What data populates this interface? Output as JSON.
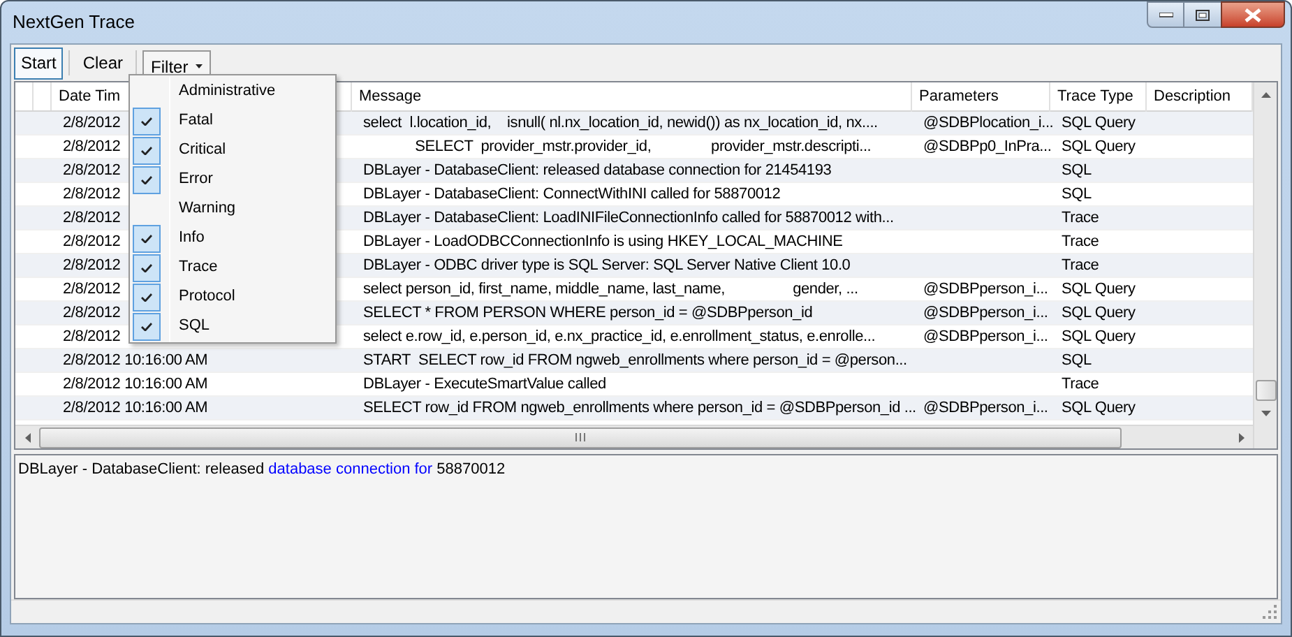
{
  "window": {
    "title": "NextGen Trace"
  },
  "toolbar": [
    {
      "kind": "button",
      "label": "Start",
      "focused": true
    },
    {
      "kind": "button",
      "label": "Clear",
      "focused": false
    },
    {
      "kind": "dropdown",
      "label": "Filter",
      "expanded": true
    }
  ],
  "filter_menu": [
    {
      "label": "Administrative",
      "checked": false
    },
    {
      "label": "Fatal",
      "checked": true
    },
    {
      "label": "Critical",
      "checked": true
    },
    {
      "label": "Error",
      "checked": true
    },
    {
      "label": "Warning",
      "checked": false
    },
    {
      "label": "Info",
      "checked": true
    },
    {
      "label": "Trace",
      "checked": true
    },
    {
      "label": "Protocol",
      "checked": true
    },
    {
      "label": "SQL",
      "checked": true
    }
  ],
  "table": {
    "columns": [
      "Date Tim",
      "Message",
      "Parameters",
      "Trace Type",
      "Description"
    ],
    "rows": [
      {
        "date": "2/8/2012",
        "message": "select  l.location_id,    isnull( nl.nx_location_id, newid()) as nx_location_id, nx....",
        "parameters": "@SDBPlocation_i...",
        "trace_type": "SQL Query"
      },
      {
        "date": "2/8/2012",
        "message": "             SELECT  provider_mstr.provider_id,               provider_mstr.descripti...",
        "parameters": "@SDBPp0_InPra...",
        "trace_type": "SQL Query"
      },
      {
        "date": "2/8/2012",
        "message": "DBLayer - DatabaseClient: released database connection for 21454193",
        "parameters": "",
        "trace_type": "SQL"
      },
      {
        "date": "2/8/2012",
        "message": "DBLayer - DatabaseClient: ConnectWithINI called for 58870012",
        "parameters": "",
        "trace_type": "SQL"
      },
      {
        "date": "2/8/2012",
        "message": "DBLayer - DatabaseClient: LoadINIFileConnectionInfo called for 58870012 with...",
        "parameters": "",
        "trace_type": "Trace"
      },
      {
        "date": "2/8/2012",
        "message": "DBLayer - LoadODBCConnectionInfo is using HKEY_LOCAL_MACHINE",
        "parameters": "",
        "trace_type": "Trace"
      },
      {
        "date": "2/8/2012",
        "message": "DBLayer - ODBC driver type is SQL Server: SQL Server Native Client 10.0",
        "parameters": "",
        "trace_type": "Trace"
      },
      {
        "date": "2/8/2012",
        "message": "select person_id, first_name, middle_name, last_name,                 gender, ...",
        "parameters": "@SDBPperson_i...",
        "trace_type": "SQL Query"
      },
      {
        "date": "2/8/2012",
        "message": "SELECT * FROM PERSON WHERE person_id = @SDBPperson_id",
        "parameters": "@SDBPperson_i...",
        "trace_type": "SQL Query"
      },
      {
        "date": "2/8/2012",
        "message": "select e.row_id, e.person_id, e.nx_practice_id, e.enrollment_status, e.enrolle...",
        "parameters": "@SDBPperson_i...",
        "trace_type": "SQL Query"
      },
      {
        "date": "2/8/2012 10:16:00 AM",
        "message": "START  SELECT row_id FROM ngweb_enrollments where person_id = @person...",
        "parameters": "",
        "trace_type": "SQL"
      },
      {
        "date": "2/8/2012 10:16:00 AM",
        "message": "DBLayer - ExecuteSmartValue called",
        "parameters": "",
        "trace_type": "Trace"
      },
      {
        "date": "2/8/2012 10:16:00 AM",
        "message": "SELECT row_id FROM ngweb_enrollments where person_id = @SDBPperson_id ...",
        "parameters": "@SDBPperson_i...",
        "trace_type": "SQL Query"
      }
    ]
  },
  "detail": [
    {
      "text": "DBLayer - DatabaseClient: released ",
      "highlighted": false
    },
    {
      "text": "database connection for",
      "highlighted": true
    },
    {
      "text": " 58870012",
      "highlighted": false
    }
  ]
}
